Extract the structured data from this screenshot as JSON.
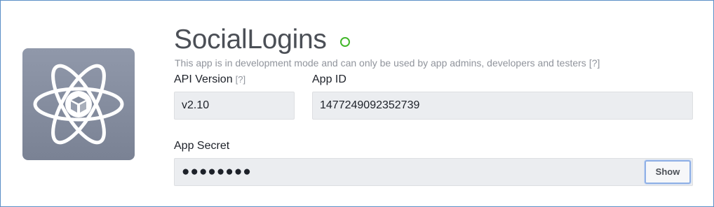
{
  "app": {
    "name": "SocialLogins",
    "status_color": "#42b72a",
    "icon": "atom-cube-icon",
    "dev_mode_note": "This app is in development mode and can only be used by app admins, developers and testers",
    "dev_mode_help": "[?]"
  },
  "fields": {
    "api_version": {
      "label": "API Version",
      "help": "[?]",
      "value": "v2.10"
    },
    "app_id": {
      "label": "App ID",
      "value": "1477249092352739"
    },
    "app_secret": {
      "label": "App Secret",
      "value": "●●●●●●●●",
      "show_label": "Show"
    }
  },
  "colors": {
    "border_accent": "#5b8fc7",
    "field_bg": "#ebedf0",
    "icon_bg": "#8890a2"
  }
}
